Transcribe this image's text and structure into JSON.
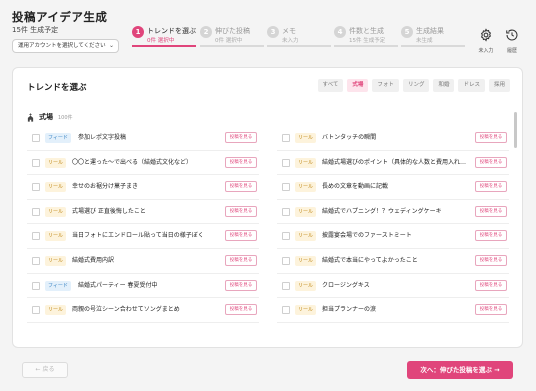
{
  "header": {
    "title": "投稿アイデア生成",
    "subtitle": "15件 生成予定",
    "account_placeholder": "運用アカウントを選択してください"
  },
  "steps": [
    {
      "num": "1",
      "label": "トレンドを選ぶ",
      "status": "0件 選択中",
      "active": true
    },
    {
      "num": "2",
      "label": "伸びた投稿",
      "status": "0件 選択中",
      "active": false
    },
    {
      "num": "3",
      "label": "メモ",
      "status": "未入力",
      "active": false
    },
    {
      "num": "4",
      "label": "件数と生成",
      "status": "15件 生成予定",
      "active": false
    },
    {
      "num": "5",
      "label": "生成結果",
      "status": "未生成",
      "active": false
    }
  ],
  "toolbar": {
    "settings_label": "未入力",
    "history_label": "履歴"
  },
  "panel": {
    "title": "トレンドを選ぶ",
    "filters": [
      "すべて",
      "式場",
      "フォト",
      "リング",
      "和婚",
      "ドレス",
      "採用"
    ],
    "active_filter": "式場",
    "category": {
      "name": "式場",
      "count": "100件",
      "icon": "church-icon"
    }
  },
  "trends_left": [
    {
      "tag": "フィード",
      "type": "feed",
      "text": "参加レポ文字投稿",
      "action": "投稿を見る"
    },
    {
      "tag": "リール",
      "type": "reel",
      "text": "〇〇と運った〜で出べる（結婚式文化など）",
      "action": "投稿を見る"
    },
    {
      "tag": "リール",
      "type": "reel",
      "text": "幸せのお裾分け菓子まき",
      "action": "投稿を見る"
    },
    {
      "tag": "リール",
      "type": "reel",
      "text": "式場選び 正直後悔したこと",
      "action": "投稿を見る"
    },
    {
      "tag": "リール",
      "type": "reel",
      "text": "当日フォトにエンドロール貼って当日の様子ぼく",
      "action": "投稿を見る"
    },
    {
      "tag": "リール",
      "type": "reel",
      "text": "結婚式費用内訳",
      "action": "投稿を見る"
    },
    {
      "tag": "フィード",
      "type": "feed",
      "text": "結婚式パーティー 春夏受付中",
      "action": "投稿を見る"
    },
    {
      "tag": "リール",
      "type": "reel",
      "text": "両親の号泣シーン合わせてソングまとめ",
      "action": "投稿を見る"
    }
  ],
  "trends_right": [
    {
      "tag": "リール",
      "type": "reel",
      "text": "バトンタッチの瞬間",
      "action": "投稿を見る"
    },
    {
      "tag": "リール",
      "type": "reel",
      "text": "結婚式場選びのポイント（具体的な人数と費用入れ…",
      "action": "投稿を見る"
    },
    {
      "tag": "リール",
      "type": "reel",
      "text": "長めの文章を動画に記載",
      "action": "投稿を見る"
    },
    {
      "tag": "リール",
      "type": "reel",
      "text": "結婚式でハプニング！？ウェディングケーキ",
      "action": "投稿を見る"
    },
    {
      "tag": "リール",
      "type": "reel",
      "text": "披露宴会場でのファーストミート",
      "action": "投稿を見る"
    },
    {
      "tag": "リール",
      "type": "reel",
      "text": "結婚式で本当にやってよかったこと",
      "action": "投稿を見る"
    },
    {
      "tag": "リール",
      "type": "reel",
      "text": "クロージングキス",
      "action": "投稿を見る"
    },
    {
      "tag": "リール",
      "type": "reel",
      "text": "担当プランナーの涙",
      "action": "投稿を見る"
    }
  ],
  "footer": {
    "back_label": "← 戻る",
    "next_label": "次へ：伸びた投稿を選ぶ →"
  },
  "colors": {
    "accent": "#e0457b",
    "reel_tag": "#c08a1a",
    "feed_tag": "#3b85c4"
  }
}
